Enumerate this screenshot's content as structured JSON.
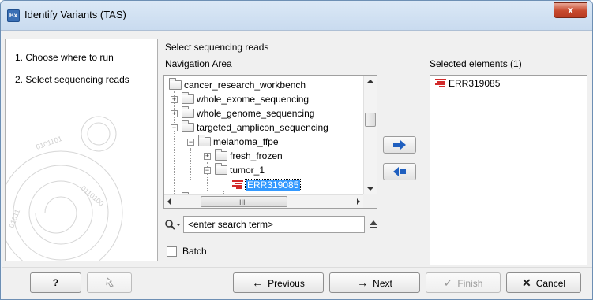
{
  "window": {
    "title": "Identify Variants (TAS)",
    "app_icon_text": "Bx",
    "close_glyph": "x"
  },
  "steps": [
    {
      "label": "1.  Choose where to run"
    },
    {
      "label": "2.  Select sequencing reads"
    }
  ],
  "main": {
    "title": "Select sequencing reads",
    "navigation_label": "Navigation Area",
    "selected_label": "Selected elements (1)"
  },
  "tree": {
    "rows": [
      {
        "label": "cancer_research_workbench",
        "type": "folder",
        "expanded": true
      },
      {
        "label": "whole_exome_sequencing",
        "type": "folder",
        "expanded": false
      },
      {
        "label": "whole_genome_sequencing",
        "type": "folder",
        "expanded": false
      },
      {
        "label": "targeted_amplicon_sequencing",
        "type": "folder",
        "expanded": true
      },
      {
        "label": "melanoma_ffpe",
        "type": "folder",
        "expanded": true
      },
      {
        "label": "fresh_frozen",
        "type": "folder",
        "expanded": false
      },
      {
        "label": "tumor_1",
        "type": "folder",
        "expanded": true
      },
      {
        "label": "ERR319085",
        "type": "sequence-list",
        "selected": true
      }
    ],
    "hscroll_grip": "III"
  },
  "search": {
    "placeholder": "<enter search term>",
    "value": "<enter search term>"
  },
  "batch": {
    "label": "Batch",
    "checked": false
  },
  "selected_elements": [
    {
      "label": "ERR319085",
      "icon": "sequence-list-icon"
    }
  ],
  "buttons": {
    "help": "?",
    "previous": "Previous",
    "next": "Next",
    "finish": "Finish",
    "cancel": "Cancel"
  },
  "colors": {
    "selection": "#3399ff",
    "sequence_icon": "#d22b2b",
    "arrow_blue": "#1f5fbf"
  }
}
